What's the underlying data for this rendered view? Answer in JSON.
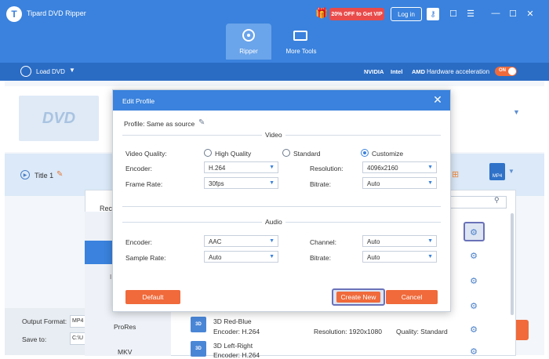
{
  "app": {
    "logo_letter": "T",
    "title": "Tipard DVD Ripper",
    "promo": "20% OFF to Get VIP",
    "login": "Log in",
    "icons": [
      "gift-icon",
      "key-icon",
      "chat-icon",
      "menu-icon",
      "minimize-icon",
      "maximize-icon",
      "close-icon"
    ]
  },
  "tabs": [
    {
      "label": "Ripper",
      "active": true
    },
    {
      "label": "More Tools",
      "active": false
    }
  ],
  "toolbar": {
    "load_dvd": "Load DVD",
    "hw": {
      "nvidia": "NVIDIA",
      "intel": "Intel",
      "amd": "AMD",
      "label": "Hardware acceleration",
      "toggle": "ON"
    }
  },
  "main": {
    "dvd_label": "DVD",
    "title_item": "Title 1",
    "format_badge": "MP4"
  },
  "profile_panel": {
    "rec_label": "Rec",
    "left_items": [
      "ProRes",
      "MKV"
    ],
    "left_letter": "I",
    "profiles": [
      {
        "icon": "3D",
        "name": "3D Red-Blue",
        "encoder": "Encoder: H.264",
        "resolution": "Resolution:  1920x1080",
        "quality": "Quality:  Standard"
      },
      {
        "icon": "3D",
        "name": "3D Left-Right",
        "encoder": "Encoder: H.264"
      }
    ]
  },
  "bottom": {
    "output_format_label": "Output Format:",
    "output_format_value": "MP4",
    "save_to_label": "Save to:",
    "save_to_value": "C:\\U"
  },
  "edit_profile": {
    "title": "Edit Profile",
    "profile": "Profile:  Same as source",
    "video_section": "Video",
    "audio_section": "Audio",
    "video": {
      "quality_label": "Video Quality:",
      "quality_options": [
        "High Quality",
        "Standard",
        "Customize"
      ],
      "quality_selected": "Customize",
      "encoder_label": "Encoder:",
      "encoder": "H.264",
      "resolution_label": "Resolution:",
      "resolution": "4096x2160",
      "frame_rate_label": "Frame Rate:",
      "frame_rate": "30fps",
      "bitrate_label": "Bitrate:",
      "bitrate": "Auto"
    },
    "audio": {
      "encoder_label": "Encoder:",
      "encoder": "AAC",
      "channel_label": "Channel:",
      "channel": "Auto",
      "sample_rate_label": "Sample Rate:",
      "sample_rate": "Auto",
      "bitrate_label": "Bitrate:",
      "bitrate": "Auto"
    },
    "buttons": {
      "default": "Default",
      "create_new": "Create New",
      "cancel": "Cancel"
    }
  },
  "colors": {
    "accent": "#3a82dd",
    "orange": "#f06a3b",
    "highlight": "#6a72b8"
  }
}
